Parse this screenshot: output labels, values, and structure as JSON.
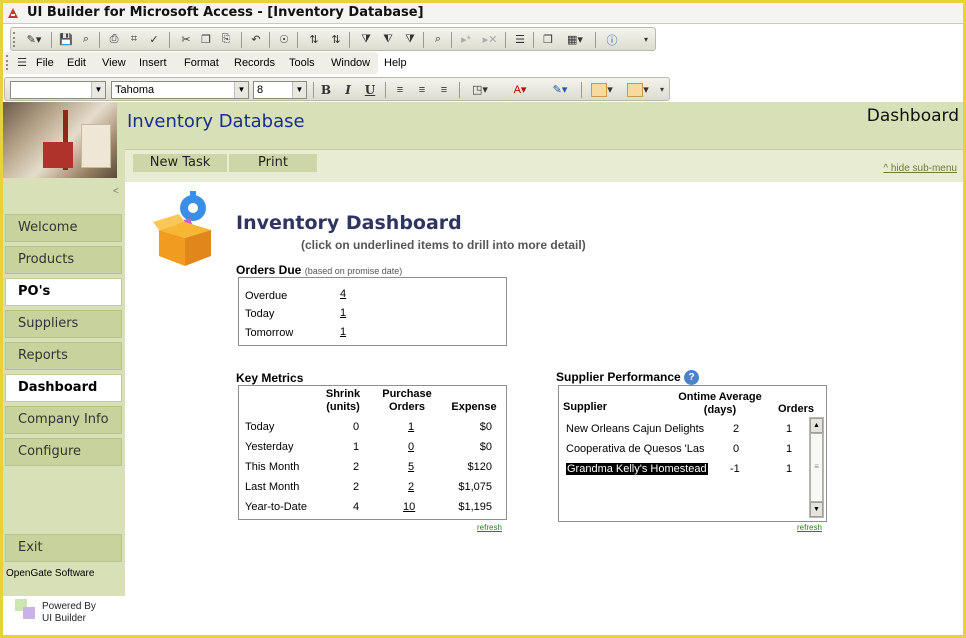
{
  "window": {
    "title": "UI Builder for Microsoft Access - [Inventory Database]"
  },
  "menu": [
    {
      "label": "File",
      "name": "menu-file"
    },
    {
      "label": "Edit",
      "name": "menu-edit"
    },
    {
      "label": "View",
      "name": "menu-view"
    },
    {
      "label": "Insert",
      "name": "menu-insert"
    },
    {
      "label": "Format",
      "name": "menu-format"
    },
    {
      "label": "Records",
      "name": "menu-records"
    },
    {
      "label": "Tools",
      "name": "menu-tools"
    },
    {
      "label": "Window",
      "name": "menu-window"
    },
    {
      "label": "Help",
      "name": "menu-help"
    }
  ],
  "format_toolbar": {
    "object_value": "",
    "font": "Tahoma",
    "size": "8",
    "bold": "B",
    "italic": "I",
    "underline": "U"
  },
  "nav": {
    "items": [
      {
        "label": "Welcome",
        "name": "nav-welcome"
      },
      {
        "label": "Products",
        "name": "nav-products"
      },
      {
        "label": "PO's",
        "name": "nav-pos"
      },
      {
        "label": "Suppliers",
        "name": "nav-suppliers"
      },
      {
        "label": "Reports",
        "name": "nav-reports"
      },
      {
        "label": "Dashboard",
        "name": "nav-dashboard"
      },
      {
        "label": "Company Info",
        "name": "nav-company-info"
      },
      {
        "label": "Configure",
        "name": "nav-configure"
      }
    ],
    "exit": "Exit",
    "company": "OpenGate Software",
    "powered_line1": "Powered By",
    "powered_line2": "UI Builder",
    "collapse_glyph": "<"
  },
  "header": {
    "db_title": "Inventory Database",
    "page": "Dashboard"
  },
  "subbar": {
    "new_task": "New Task",
    "print": "Print",
    "hide_submenu": "hide sub-menu",
    "hide_glyph": "^"
  },
  "dashboard": {
    "title": "Inventory Dashboard",
    "subtitle": "(click on underlined items to drill into more detail)"
  },
  "orders_due": {
    "title": "Orders Due",
    "note": "(based on promise date)",
    "rows": [
      {
        "label": "Overdue",
        "value": "4"
      },
      {
        "label": "Today",
        "value": "1"
      },
      {
        "label": "Tomorrow",
        "value": "1"
      }
    ]
  },
  "key_metrics": {
    "title": "Key Metrics",
    "headers": {
      "shrink_1": "Shrink",
      "shrink_2": "(units)",
      "po_1": "Purchase",
      "po_2": "Orders",
      "expense": "Expense"
    },
    "rows": [
      {
        "label": "Today",
        "shrink": "0",
        "orders": "1",
        "expense": "$0"
      },
      {
        "label": "Yesterday",
        "shrink": "1",
        "orders": "0",
        "expense": "$0"
      },
      {
        "label": "This Month",
        "shrink": "2",
        "orders": "5",
        "expense": "$120"
      },
      {
        "label": "Last Month",
        "shrink": "2",
        "orders": "2",
        "expense": "$1,075"
      },
      {
        "label": "Year-to-Date",
        "shrink": "4",
        "orders": "10",
        "expense": "$1,195"
      }
    ],
    "refresh": "refresh"
  },
  "supplier_performance": {
    "title": "Supplier Performance",
    "help_glyph": "?",
    "headers": {
      "supplier": "Supplier",
      "ontime_1": "Ontime Average",
      "ontime_2": "(days)",
      "orders": "Orders"
    },
    "rows": [
      {
        "supplier": "New Orleans Cajun Delights",
        "ontime": "2",
        "orders": "1"
      },
      {
        "supplier": "Cooperativa de Quesos 'Las",
        "ontime": "0",
        "orders": "1"
      },
      {
        "supplier": "Grandma Kelly's Homestead",
        "ontime": "-1",
        "orders": "1"
      }
    ],
    "refresh": "refresh"
  },
  "colors": {
    "accent_band": "#d8e0b8",
    "nav_button": "#c8d29c",
    "db_title": "#1a2f8a",
    "refresh_link": "#2e7d1e",
    "window_border": "#e8d23a"
  }
}
